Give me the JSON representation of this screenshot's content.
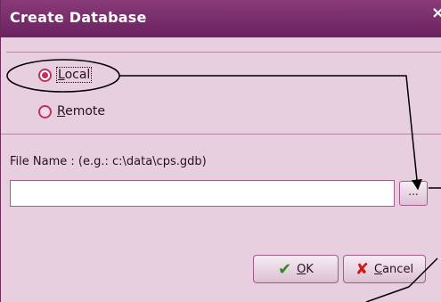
{
  "dialog": {
    "title": "Create Database",
    "close_glyph": "×"
  },
  "location": {
    "options": [
      {
        "label": "Local",
        "selected": true
      },
      {
        "label": "Remote",
        "selected": false
      }
    ]
  },
  "file": {
    "label": "File Name :  (e.g.: c:\\data\\cps.gdb)",
    "value": "",
    "browse_label": "..."
  },
  "buttons": {
    "ok": {
      "label": "OK",
      "icon": "checkmark-icon"
    },
    "cancel": {
      "label": "Cancel",
      "icon": "x-icon"
    }
  },
  "colors": {
    "titlebar": "#7a2e6c",
    "dialog_bg": "#e8cfe0",
    "accent": "#c0325a"
  }
}
